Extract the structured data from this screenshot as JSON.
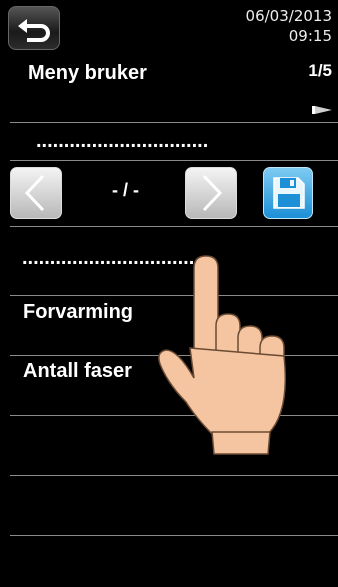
{
  "header": {
    "date": "06/03/2013",
    "time": "09:15",
    "back_icon": "back-arrow-icon"
  },
  "menu": {
    "title": "Meny bruker",
    "page": "1/5",
    "next_icon": "next-page-arrow-icon",
    "selected_value": "...............................",
    "range": "- / -",
    "value_line": "..............................."
  },
  "items": [
    {
      "label": "Forvarming"
    },
    {
      "label": "Antall faser"
    },
    {
      "label": ""
    },
    {
      "label": ""
    },
    {
      "label": ""
    }
  ],
  "colors": {
    "save_button": "#1c8fd6",
    "hand": "#f4c5a0"
  }
}
